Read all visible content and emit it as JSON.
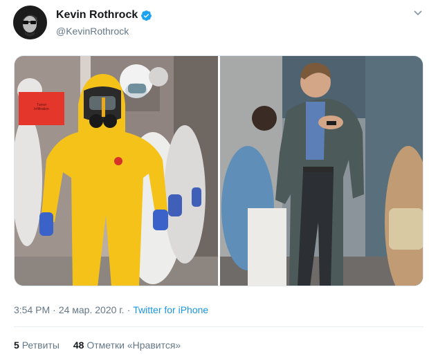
{
  "author": {
    "display_name": "Kevin Rothrock",
    "handle": "@KevinRothrock",
    "verified_icon": "verified-badge-icon",
    "avatar_icon": "avatar-icon"
  },
  "menu_icon": "chevron-down-icon",
  "media": {
    "left_photo": {
      "sticker_line1": "Tumor",
      "sticker_line2": "Infiltration"
    },
    "right_photo": {}
  },
  "meta": {
    "time": "3:54 PM",
    "separator": "·",
    "date": "24 мар. 2020 г.",
    "source": "Twitter for iPhone"
  },
  "stats": {
    "retweets_count": "5",
    "retweets_label": "Ретвиты",
    "likes_count": "48",
    "likes_label": "Отметки «Нравится»"
  },
  "colors": {
    "link": "#1b95e0",
    "secondary_text": "#657786",
    "verified": "#1da1f2"
  }
}
